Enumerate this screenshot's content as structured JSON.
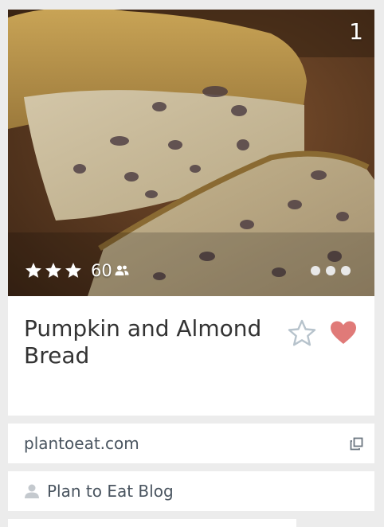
{
  "recipe": {
    "rank": "1",
    "rating_stars": 3,
    "review_count": "60",
    "title": "Pumpkin and Almond Bread",
    "source_site": "plantoeat.com",
    "author": "Plan to Eat Blog"
  },
  "icons": {
    "rating": "star-icon",
    "people": "people-icon",
    "more": "more-dots-icon",
    "favorite": "star-outline-icon",
    "like": "heart-icon",
    "external": "external-link-icon",
    "author": "person-icon"
  },
  "colors": {
    "heart": "#e07a78",
    "star_outline": "#b7c3cc",
    "text": "#333333",
    "row_text": "#4a5560"
  }
}
